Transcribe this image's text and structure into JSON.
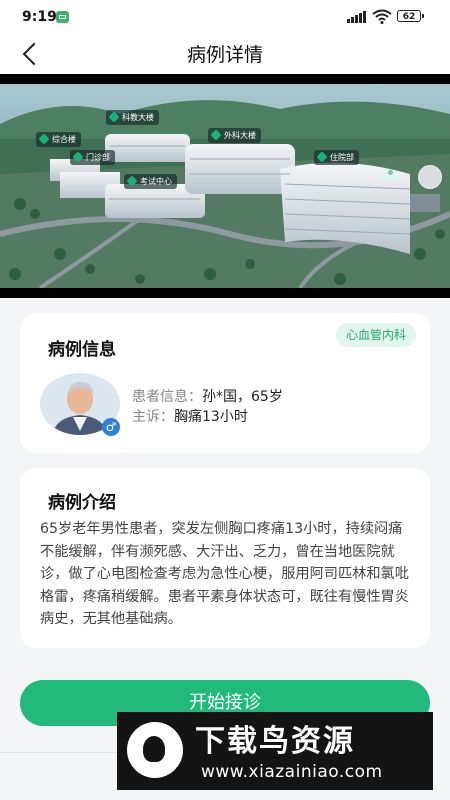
{
  "status_bar": {
    "time": "9:19",
    "battery": "62"
  },
  "nav": {
    "title": "病例详情"
  },
  "hero": {
    "building_labels": [
      "综合楼",
      "科教大楼",
      "外科大楼",
      "门诊部",
      "住院部",
      "考试中心"
    ]
  },
  "case_info": {
    "title": "病例信息",
    "department": "心血管内科",
    "patient_label": "患者信息：",
    "patient_value": "孙*国，65岁",
    "complaint_label": "主诉：",
    "complaint_value": "胸痛13小时",
    "gender_symbol": "♂"
  },
  "case_intro": {
    "title": "病例介绍",
    "text": "65岁老年男性患者，突发左侧胸口疼痛13小时，持续闷痛不能缓解，伴有濒死感、大汗出、乏力，曾在当地医院就诊，做了心电图检查考虑为急性心梗，服用阿司匹林和氯吡格雷，疼痛稍缓解。患者平素身体状态可，既往有慢性胃炎病史，无其他基础病。"
  },
  "actions": {
    "start_button": "开始接诊"
  },
  "watermark": {
    "title": "下载鸟资源",
    "url": "www.xiazainiao.com"
  },
  "colors": {
    "accent": "#22b97c",
    "badge_bg": "#e2f6ee",
    "badge_text": "#1fa874",
    "gender": "#2f7fd8"
  }
}
